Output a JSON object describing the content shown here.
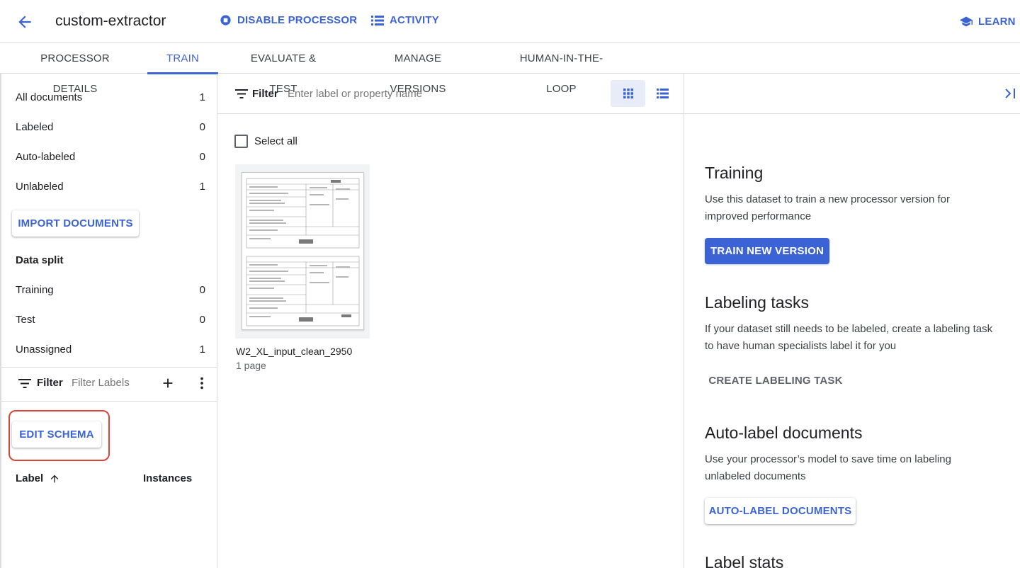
{
  "header": {
    "title": "custom-extractor",
    "disable_label": "DISABLE PROCESSOR",
    "activity_label": "ACTIVITY",
    "learn_label": "LEARN"
  },
  "tabs": [
    {
      "label": "PROCESSOR DETAILS",
      "active": false
    },
    {
      "label": "TRAIN",
      "active": true
    },
    {
      "label": "EVALUATE & TEST",
      "active": false
    },
    {
      "label": "MANAGE VERSIONS",
      "active": false
    },
    {
      "label": "HUMAN-IN-THE-LOOP",
      "active": false
    }
  ],
  "left": {
    "stats": [
      {
        "label": "All documents",
        "count": "1"
      },
      {
        "label": "Labeled",
        "count": "0"
      },
      {
        "label": "Auto-labeled",
        "count": "0"
      },
      {
        "label": "Unlabeled",
        "count": "1"
      }
    ],
    "import_label": "IMPORT DOCUMENTS",
    "data_split_title": "Data split",
    "split": [
      {
        "label": "Training",
        "count": "0"
      },
      {
        "label": "Test",
        "count": "0"
      },
      {
        "label": "Unassigned",
        "count": "1"
      }
    ],
    "filter_label": "Filter",
    "filter_placeholder": "Filter Labels",
    "edit_schema_label": "EDIT SCHEMA",
    "col_label": "Label",
    "col_instances": "Instances"
  },
  "middle": {
    "filter_label": "Filter",
    "filter_placeholder": "Enter label or property name",
    "select_all": "Select all",
    "document": {
      "name": "W2_XL_input_clean_2950",
      "pages": "1 page"
    }
  },
  "right": {
    "training_title": "Training",
    "training_text": "Use this dataset to train a new processor version for improved performance",
    "train_button": "TRAIN NEW VERSION",
    "labeling_title": "Labeling tasks",
    "labeling_text": "If your dataset still needs to be labeled, create a labeling task to have human specialists label it for you",
    "labeling_button": "CREATE LABELING TASK",
    "autolabel_title": "Auto-label documents",
    "autolabel_text": "Use your processor’s model to save time on labeling unlabeled documents",
    "autolabel_button": "AUTO-LABEL DOCUMENTS",
    "stats_title": "Label stats"
  },
  "colors": {
    "accent": "#3b63d6",
    "highlight": "#d9453a"
  }
}
